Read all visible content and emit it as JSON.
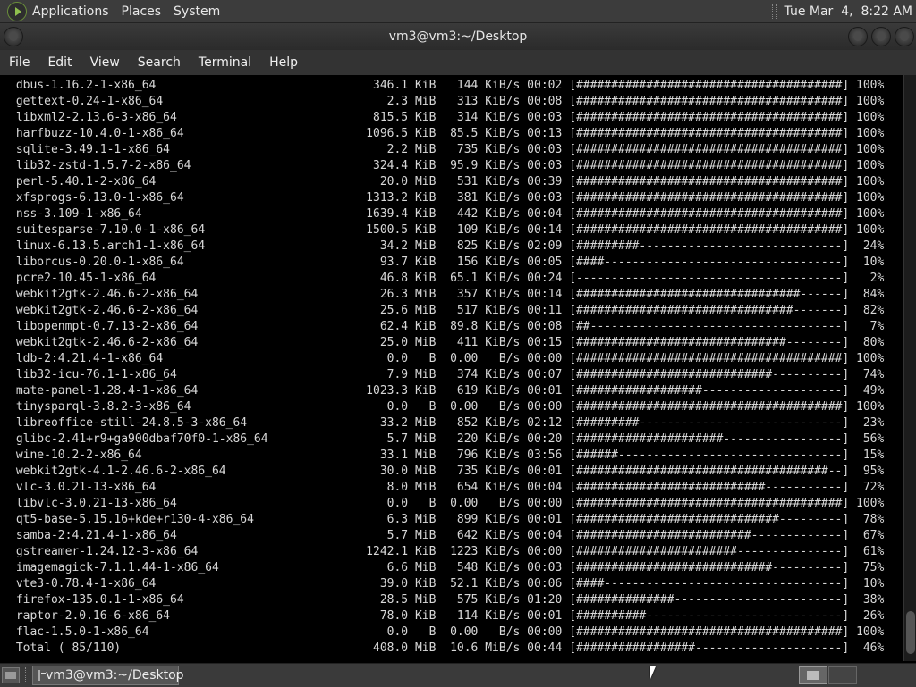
{
  "top_panel": {
    "menus": [
      "Applications",
      "Places",
      "System"
    ],
    "clock": "Tue Mar  4,  8:22 AM"
  },
  "window": {
    "title": "vm3@vm3:~/Desktop"
  },
  "menubar": [
    "File",
    "Edit",
    "View",
    "Search",
    "Terminal",
    "Help"
  ],
  "terminal": {
    "lines": [
      " dbus-1.16.2-1-x86_64                               346.1 KiB   144 KiB/s 00:02 [######################################] 100%",
      " gettext-0.24-1-x86_64                                2.3 MiB   313 KiB/s 00:08 [######################################] 100%",
      " libxml2-2.13.6-3-x86_64                            815.5 KiB   314 KiB/s 00:03 [######################################] 100%",
      " harfbuzz-10.4.0-1-x86_64                          1096.5 KiB  85.5 KiB/s 00:13 [######################################] 100%",
      " sqlite-3.49.1-1-x86_64                               2.2 MiB   735 KiB/s 00:03 [######################################] 100%",
      " lib32-zstd-1.5.7-2-x86_64                          324.4 KiB  95.9 KiB/s 00:03 [######################################] 100%",
      " perl-5.40.1-2-x86_64                                20.0 MiB   531 KiB/s 00:39 [######################################] 100%",
      " xfsprogs-6.13.0-1-x86_64                          1313.2 KiB   381 KiB/s 00:03 [######################################] 100%",
      " nss-3.109-1-x86_64                                1639.4 KiB   442 KiB/s 00:04 [######################################] 100%",
      " suitesparse-7.10.0-1-x86_64                       1500.5 KiB   109 KiB/s 00:14 [######################################] 100%",
      " linux-6.13.5.arch1-1-x86_64                         34.2 MiB   825 KiB/s 02:09 [#########-----------------------------]  24%",
      " liborcus-0.20.0-1-x86_64                            93.7 KiB   156 KiB/s 00:05 [####----------------------------------]  10%",
      " pcre2-10.45-1-x86_64                                46.8 KiB  65.1 KiB/s 00:24 [--------------------------------------]   2%",
      " webkit2gtk-2.46.6-2-x86_64                          26.3 MiB   357 KiB/s 00:14 [################################------]  84%",
      " webkit2gtk-2.46.6-2-x86_64                          25.6 MiB   517 KiB/s 00:11 [###############################-------]  82%",
      " libopenmpt-0.7.13-2-x86_64                          62.4 KiB  89.8 KiB/s 00:08 [##------------------------------------]   7%",
      " webkit2gtk-2.46.6-2-x86_64                          25.0 MiB   411 KiB/s 00:15 [##############################--------]  80%",
      " ldb-2:4.21.4-1-x86_64                                0.0   B  0.00   B/s 00:00 [######################################] 100%",
      " lib32-icu-76.1-1-x86_64                              7.9 MiB   374 KiB/s 00:07 [############################----------]  74%",
      " mate-panel-1.28.4-1-x86_64                        1023.3 KiB   619 KiB/s 00:01 [##################--------------------]  49%",
      " tinysparql-3.8.2-3-x86_64                            0.0   B  0.00   B/s 00:00 [######################################] 100%",
      " libreoffice-still-24.8.5-3-x86_64                   33.2 MiB   852 KiB/s 02:12 [#########-----------------------------]  23%",
      " glibc-2.41+r9+ga900dbaf70f0-1-x86_64                 5.7 MiB   220 KiB/s 00:20 [#####################-----------------]  56%",
      " wine-10.2-2-x86_64                                  33.1 MiB   796 KiB/s 03:56 [######--------------------------------]  15%",
      " webkit2gtk-4.1-2.46.6-2-x86_64                      30.0 MiB   735 KiB/s 00:01 [####################################--]  95%",
      " vlc-3.0.21-13-x86_64                                 8.0 MiB   654 KiB/s 00:04 [###########################-----------]  72%",
      " libvlc-3.0.21-13-x86_64                              0.0   B  0.00   B/s 00:00 [######################################] 100%",
      " qt5-base-5.15.16+kde+r130-4-x86_64                   6.3 MiB   899 KiB/s 00:01 [#############################---------]  78%",
      " samba-2:4.21.4-1-x86_64                              5.7 MiB   642 KiB/s 00:04 [#########################-------------]  67%",
      " gstreamer-1.24.12-3-x86_64                        1242.1 KiB  1223 KiB/s 00:00 [#######################---------------]  61%",
      " imagemagick-7.1.1.44-1-x86_64                        6.6 MiB   548 KiB/s 00:03 [############################----------]  75%",
      " vte3-0.78.4-1-x86_64                                39.0 KiB  52.1 KiB/s 00:06 [####----------------------------------]  10%",
      " firefox-135.0.1-1-x86_64                            28.5 MiB   575 KiB/s 01:20 [##############------------------------]  38%",
      " raptor-2.0.16-6-x86_64                              78.0 KiB   114 KiB/s 00:01 [##########----------------------------]  26%",
      " flac-1.5.0-1-x86_64                                  0.0   B  0.00   B/s 00:00 [######################################] 100%",
      " Total ( 85/110)                                    408.0 MiB  10.6 MiB/s 00:44 [#################---------------------]  46%"
    ]
  },
  "taskbar": {
    "window_label": "vm3@vm3:~/Desktop"
  }
}
